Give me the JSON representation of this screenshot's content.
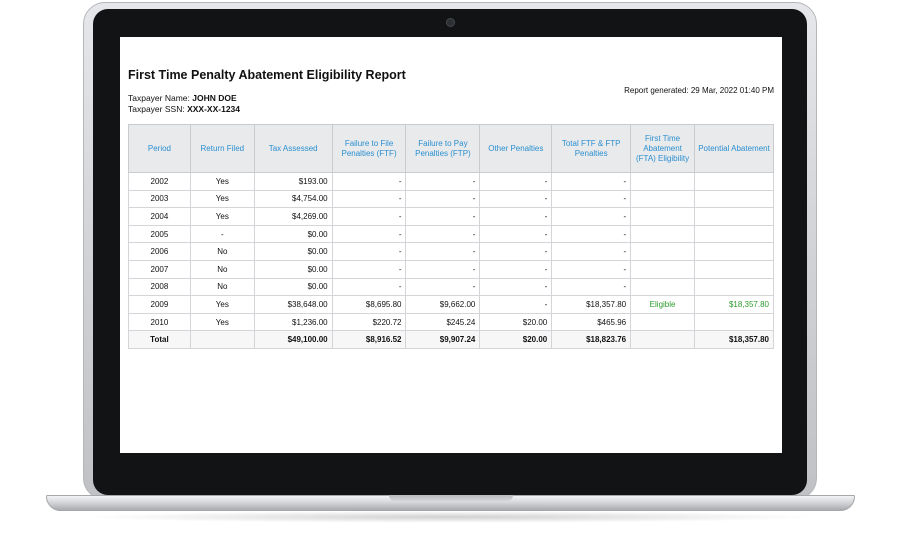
{
  "report": {
    "title": "First Time Penalty Abatement Eligibility Report",
    "taxpayer_name_label": "Taxpayer Name:",
    "taxpayer_name": "JOHN DOE",
    "taxpayer_ssn_label": "Taxpayer SSN:",
    "taxpayer_ssn": "XXX-XX-1234",
    "generated": "Report generated: 29 Mar, 2022 01:40 PM"
  },
  "table": {
    "headers": [
      "Period",
      "Return Filed",
      "Tax Assessed",
      "Failure to File Penalties (FTF)",
      "Failure to Pay Penalties (FTP)",
      "Other Penalties",
      "Total FTF & FTP Penalties",
      "First Time Abatement (FTA) Eligibility",
      "Potential Abatement"
    ],
    "rows": [
      [
        "2002",
        "Yes",
        "$193.00",
        "-",
        "-",
        "-",
        "-",
        "",
        ""
      ],
      [
        "2003",
        "Yes",
        "$4,754.00",
        "-",
        "-",
        "-",
        "-",
        "",
        ""
      ],
      [
        "2004",
        "Yes",
        "$4,269.00",
        "-",
        "-",
        "-",
        "-",
        "",
        ""
      ],
      [
        "2005",
        "-",
        "$0.00",
        "-",
        "-",
        "-",
        "-",
        "",
        ""
      ],
      [
        "2006",
        "No",
        "$0.00",
        "-",
        "-",
        "-",
        "-",
        "",
        ""
      ],
      [
        "2007",
        "No",
        "$0.00",
        "-",
        "-",
        "-",
        "-",
        "",
        ""
      ],
      [
        "2008",
        "No",
        "$0.00",
        "-",
        "-",
        "-",
        "-",
        "",
        ""
      ],
      [
        "2009",
        "Yes",
        "$38,648.00",
        "$8,695.80",
        "$9,662.00",
        "-",
        "$18,357.80",
        "Eligible",
        "$18,357.80"
      ],
      [
        "2010",
        "Yes",
        "$1,236.00",
        "$220.72",
        "$245.24",
        "$20.00",
        "$465.96",
        "",
        ""
      ]
    ],
    "total": [
      "Total",
      "",
      "$49,100.00",
      "$8,916.52",
      "$9,907.24",
      "$20.00",
      "$18,823.76",
      "",
      "$18,357.80"
    ]
  },
  "colors": {
    "header_text": "#2a8fd0",
    "eligible_text": "#2e9b2e",
    "header_bg": "#e9eaec"
  }
}
